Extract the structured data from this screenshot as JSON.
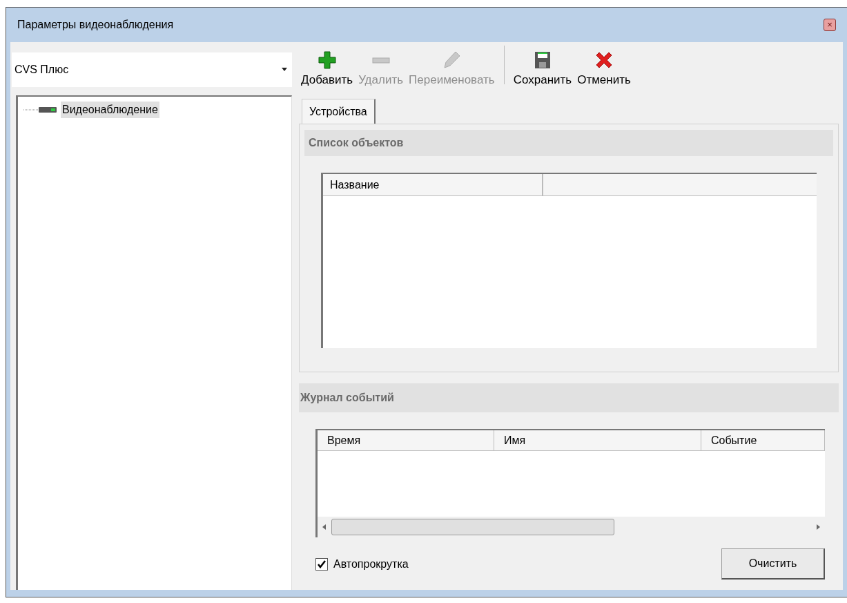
{
  "window": {
    "title": "Параметры видеонаблюдения",
    "close": "×"
  },
  "selector": {
    "value": "CVS Плюс"
  },
  "tree": [
    {
      "label": "Видеонаблюдение",
      "selected": true
    }
  ],
  "toolbar": [
    {
      "kind": "add",
      "label": "Добавить",
      "disabled": false
    },
    {
      "kind": "remove",
      "label": "Удалить",
      "disabled": true
    },
    {
      "kind": "rename",
      "label": "Переименовать",
      "disabled": true
    },
    {
      "kind": "save",
      "label": "Сохранить",
      "disabled": false
    },
    {
      "kind": "cancel",
      "label": "Отменить",
      "disabled": false
    }
  ],
  "tabs": [
    {
      "label": "Устройства",
      "selected": true
    }
  ],
  "objects": {
    "title": "Список объектов",
    "columns": [
      "Название"
    ]
  },
  "journal": {
    "title": "Журнал событий",
    "columns": [
      "Время",
      "Имя",
      "Событие"
    ]
  },
  "autoscroll": {
    "label": "Автопрокрутка",
    "checked": true
  },
  "clear_button": "Очистить"
}
